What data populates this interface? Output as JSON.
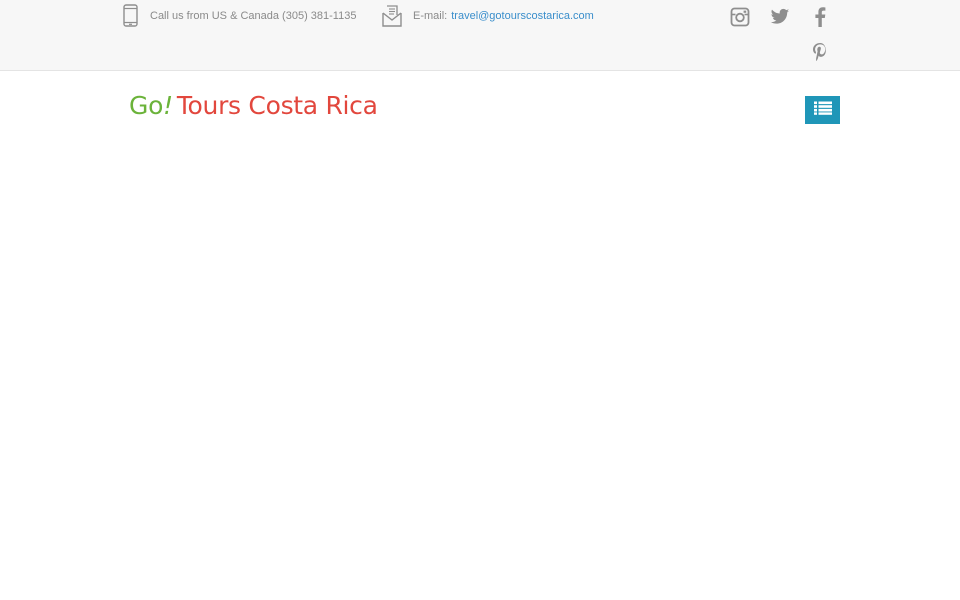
{
  "topbar": {
    "phone_text": "Call us from US & Canada (305) 381-1135",
    "email_label": "E-mail:",
    "email_address": "travel@gotourscostarica.com",
    "icons": {
      "phone": "mobile-phone-icon",
      "email": "envelope-icon"
    },
    "social": [
      "instagram-icon",
      "twitter-icon",
      "facebook-icon",
      "pinterest-icon"
    ]
  },
  "header": {
    "logo_go": "Go",
    "logo_bang": "!",
    "logo_rest": "Tours Costa Rica",
    "menu_icon": "list-menu-icon"
  },
  "colors": {
    "logo_green": "#6bb33a",
    "logo_red": "#e2473d",
    "menu_button": "#1f96b8",
    "link": "#3a8ecb",
    "topbar_bg": "#f7f7f7",
    "icon_grey": "#8e8e8e"
  }
}
